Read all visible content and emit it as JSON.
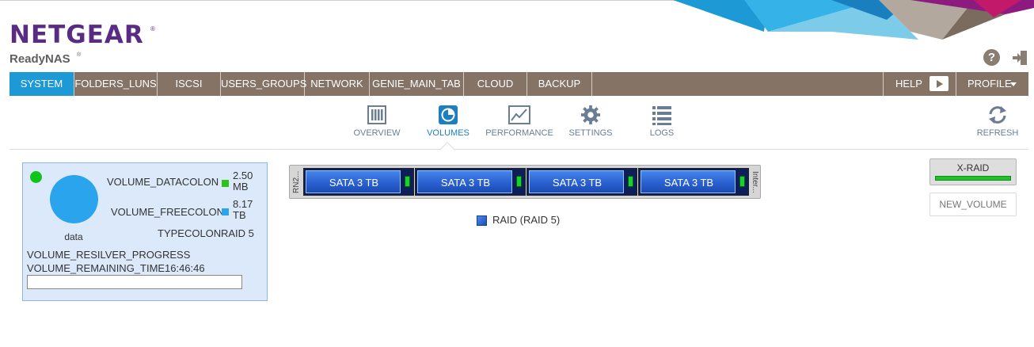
{
  "brand": {
    "logo": "NETGEAR",
    "logo_mark": "®",
    "product": "ReadyNAS",
    "product_mark": "®"
  },
  "header": {
    "help_icon": "question-circle-icon",
    "help_glyph": "?",
    "logout_icon": "logout-icon"
  },
  "nav": {
    "tabs": [
      {
        "label": "SYSTEM",
        "active": true
      },
      {
        "label": "FOLDERS_LUNS"
      },
      {
        "label": "ISCSI"
      },
      {
        "label": "USERS_GROUPS"
      },
      {
        "label": "NETWORK"
      },
      {
        "label": "GENIE_MAIN_TAB"
      },
      {
        "label": "CLOUD"
      },
      {
        "label": "BACKUP"
      }
    ],
    "help_label": "HELP",
    "profile_label": "PROFILE",
    "colors": {
      "bar": "#857366",
      "active": "#1d9ad6"
    }
  },
  "subtabs": {
    "items": [
      {
        "label": "OVERVIEW",
        "icon": "overview-icon"
      },
      {
        "label": "VOLUMES",
        "icon": "volumes-icon",
        "active": true
      },
      {
        "label": "PERFORMANCE",
        "icon": "performance-icon"
      },
      {
        "label": "SETTINGS",
        "icon": "gear-icon"
      },
      {
        "label": "LOGS",
        "icon": "list-icon"
      }
    ],
    "refresh_label": "REFRESH"
  },
  "volume": {
    "name": "data",
    "status_color": "#10c41a",
    "data_label": "VOLUME_DATACOLON",
    "data_value": "2.50 MB",
    "data_color": "#2ec21f",
    "free_label": "VOLUME_FREECOLON",
    "free_value": "8.17 TB",
    "free_color": "#2aa4ec",
    "type_label": "TYPECOLON",
    "type_value": "RAID 5",
    "resilver_label": "VOLUME_RESILVER_PROGRESS",
    "remaining_label": "VOLUME_REMAINING_TIME",
    "remaining_value": "16:46:46",
    "resilver_progress": 0.0
  },
  "chassis": {
    "left_label": "RN2...",
    "right_label": "Inter...",
    "drives": [
      {
        "label": "SATA 3 TB"
      },
      {
        "label": "SATA 3 TB"
      },
      {
        "label": "SATA 3 TB"
      },
      {
        "label": "SATA 3 TB"
      }
    ]
  },
  "raid_legend": {
    "label": "RAID (RAID 5)"
  },
  "actions": {
    "xraid_label": "X-RAID",
    "xraid_enabled": true,
    "new_volume_label": "NEW_VOLUME"
  }
}
